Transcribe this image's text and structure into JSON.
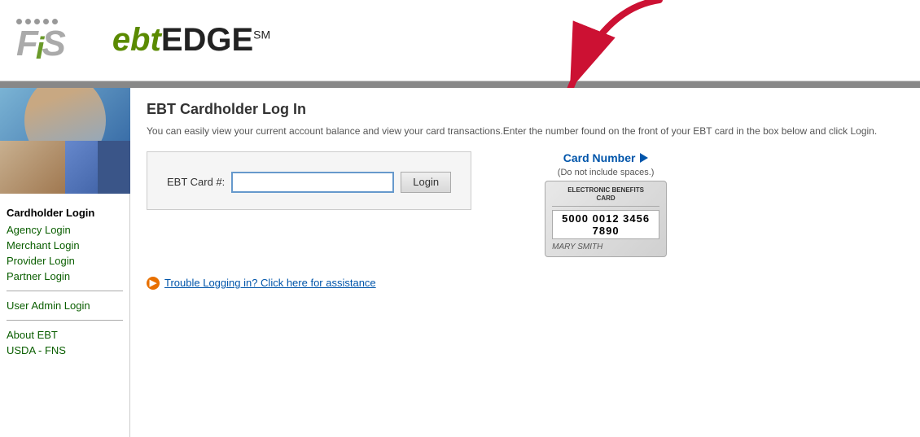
{
  "header": {
    "fis_logo_text": "FiS",
    "ebt_part": "ebt",
    "edge_part": "EDGE",
    "sm_part": "SM"
  },
  "topbar": {},
  "sidebar": {
    "cardholder_login_label": "Cardholder Login",
    "agency_login_label": "Agency Login",
    "merchant_login_label": "Merchant Login",
    "provider_login_label": "Provider Login",
    "partner_login_label": "Partner Login",
    "user_admin_login_label": "User Admin Login",
    "about_ebt_label": "About EBT",
    "usda_fns_label": "USDA - FNS"
  },
  "main": {
    "page_title": "EBT Cardholder Log In",
    "description": "You can easily view your current account balance and view your card transactions.Enter the number found on the front of your EBT card in the box below and click Login.",
    "form": {
      "label": "EBT Card #:",
      "input_value": "",
      "input_placeholder": "",
      "login_button": "Login"
    },
    "card_demo": {
      "card_number_label": "Card Number",
      "card_subtitle": "(Do not include spaces.)",
      "card_header_line1": "ELECTRONIC BENEFITS",
      "card_header_line2": "CARD",
      "card_number": "5000 0012 3456 7890",
      "card_name": "MARY SMITH"
    },
    "trouble": {
      "link_text": "Trouble Logging in? Click here for assistance"
    }
  }
}
